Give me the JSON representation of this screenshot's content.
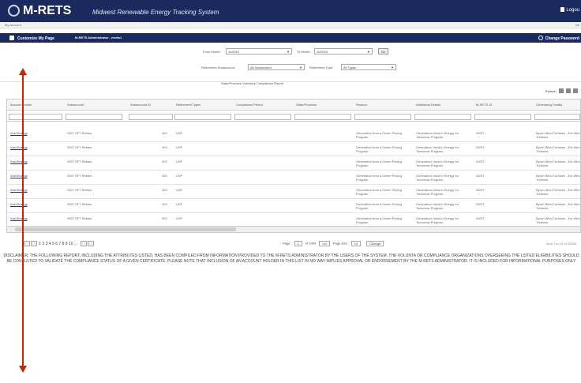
{
  "header": {
    "logo": "M-RETS",
    "tagline": "Midwest Renewable Energy Tracking System",
    "logout": "Logou"
  },
  "subbar": {
    "account": "My Account",
    "right": "He"
  },
  "nav": {
    "customize": "Customize My Page",
    "admin": "M-RETS Administrator - mrets1",
    "change_password": "Change Password"
  },
  "filters": {
    "from_label": "From Month:",
    "from_value": "11/2007",
    "to_label": "To Month:",
    "to_value": "11/2010",
    "go": "Go",
    "subaccount_label": "Retirement Subaccount:",
    "subaccount_value": "All Subaccount",
    "type_label": "Retirement Type:",
    "type_value": "All Types"
  },
  "report_title": "State/Province Voluntary Compliance Report",
  "tools": {
    "refresh": "Refresh"
  },
  "columns": [
    "Account Holder",
    "Subaccount",
    "Subaccount ID",
    "Retirement Types",
    "Compliance Period",
    "State/Province",
    "Reason",
    "Additional Details",
    "M-RETS ID",
    "Generating Facility"
  ],
  "rows": [
    {
      "holder": "Xcel Energy",
      "sub": "2007 SFT Retires",
      "id": "402",
      "type": "USP",
      "reason": "Generation from a Green Pricing Program",
      "details": "Generation Used in Energy for Tomorrow Program",
      "mrets": "W237",
      "facility": "Byron Wind Turbines - Ext Wind Turbines"
    },
    {
      "holder": "Xcel Energy",
      "sub": "2007 SFT Retires",
      "id": "402",
      "type": "USP",
      "reason": "Generation from a Green Pricing Program",
      "details": "Generation Used in Energy for Tomorrow Program",
      "mrets": "W237",
      "facility": "Byron Wind Turbines - Ext Wind Turbines"
    },
    {
      "holder": "Xcel Energy",
      "sub": "2007 SFT Retires",
      "id": "402",
      "type": "USP",
      "reason": "Generation from a Green Pricing Program",
      "details": "Generation Used in Energy for Tomorrow Program",
      "mrets": "W237",
      "facility": "Byron Wind Turbines - Ext Wind Turbines"
    },
    {
      "holder": "Xcel Energy",
      "sub": "2007 SFT Retires",
      "id": "402",
      "type": "USP",
      "reason": "Generation from a Green Pricing Program",
      "details": "Generation Used in Energy for Tomorrow Program",
      "mrets": "W237",
      "facility": "Byron Wind Turbines - Ext Wind Turbines"
    },
    {
      "holder": "Xcel Energy",
      "sub": "2007 SFT Retires",
      "id": "402",
      "type": "USP",
      "reason": "Generation from a Green Pricing Program",
      "details": "Generation Used in Energy for Tomorrow Program",
      "mrets": "W237",
      "facility": "Byron Wind Turbines - Ext Wind Turbines"
    },
    {
      "holder": "Xcel Energy",
      "sub": "2007 SFT Retires",
      "id": "402",
      "type": "USP",
      "reason": "Generation from a Green Pricing Program",
      "details": "Generation Used in Energy for Tomorrow Program",
      "mrets": "W237",
      "facility": "Byron Wind Turbines - Ext Wind Turbines"
    },
    {
      "holder": "Xcel Energy",
      "sub": "2007 SFT Retires",
      "id": "402",
      "type": "USP",
      "reason": "Generation from a Green Pricing Program",
      "details": "Generation Used in Energy for Tomorrow Program",
      "mrets": "W237",
      "facility": "Byron Wind Turbines - Ext Wind Turbines"
    }
  ],
  "pager": {
    "pages": "1 2 3 4 5 6 7 8 9 10 ...",
    "page_label": "Page:",
    "page_value": "1",
    "of_label": "of 2004",
    "go": "Go",
    "size_label": "Page size:",
    "size_value": "10",
    "change": "Change",
    "items": "Item 1 to 10 of 20038"
  },
  "disclaimer": "DISCLAIMER: THE FOLLOWING REPORT, INCLUDING THE ATTRIBUTES LISTED, HAS BEEN COMPILED FROM INFORMATION PROVIDED TO THE M-RETS ADMINISTRATOR BY THE USERS OF THE SYSTEM. THE VOLUNTA OR COMPLIANCE ORGANIZATIONS OVERSEEING THE LISTED ELIGIBILITIES SHOULD BE CONSULTED TO VALIDATE THE COMPLIANCE STATUS OF A GIVEN CERTIFICATE. PLEASE NOTE THAT INCLUSION OF AN ACCOUNT HOLDER IN THIS LIST IN NO WAY IMPLIES APPROVAL OR ENDORSEMENT BY THE M-RETS ADMINISTRATOR. IT IS INCLUDED FOR INFORMATIONAL PURPOSES ONLY"
}
